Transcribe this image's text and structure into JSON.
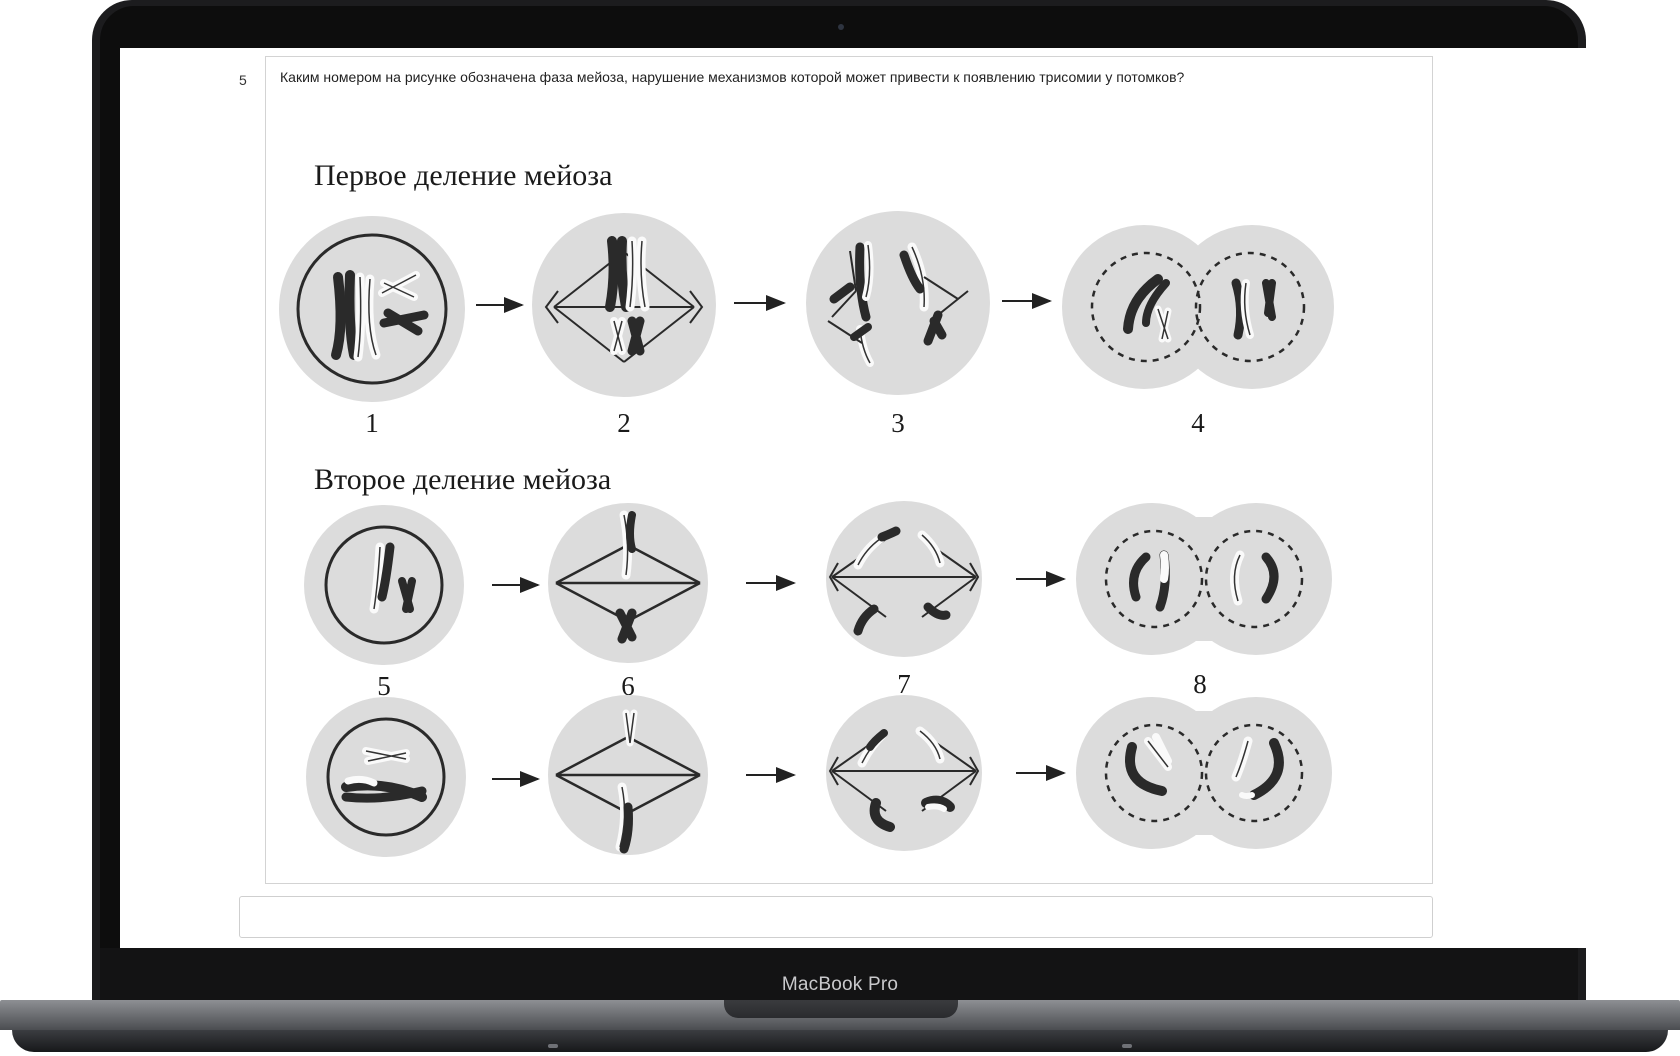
{
  "device": {
    "brand": "MacBook Pro"
  },
  "question": {
    "number": "5",
    "text": "Каким номером на рисунке обозначена фаза мейоза, нарушение механизмов которой может привести к появлению трисомии у потомков?"
  },
  "figure": {
    "first_division_title": "Первое деление мейоза",
    "second_division_title": "Второе деление мейоза",
    "stage_labels": [
      "1",
      "2",
      "3",
      "4",
      "5",
      "6",
      "7",
      "8"
    ]
  },
  "answer": {
    "value": ""
  }
}
